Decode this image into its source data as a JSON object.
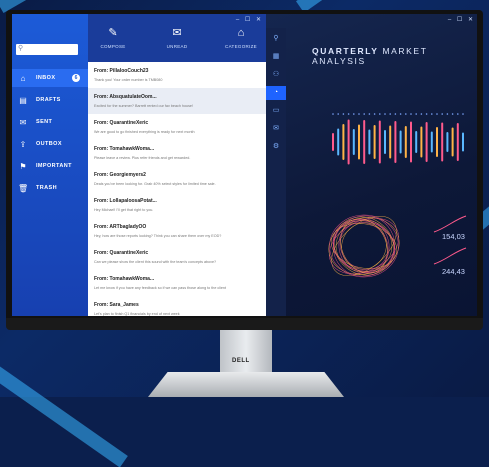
{
  "window_controls": "– ☐ ✕",
  "search": {
    "placeholder": ""
  },
  "sidebar": {
    "items": [
      {
        "label": "INBOX",
        "icon": "inbox-icon",
        "badge": "6"
      },
      {
        "label": "DRAFTS",
        "icon": "draft-icon"
      },
      {
        "label": "SENT",
        "icon": "sent-icon"
      },
      {
        "label": "OUTBOX",
        "icon": "outbox-icon"
      },
      {
        "label": "IMPORTANT",
        "icon": "flag-icon"
      },
      {
        "label": "TRASH",
        "icon": "trash-icon"
      }
    ]
  },
  "toolbar": {
    "compose": "COMPOSE",
    "unread": "UNREAD",
    "categorize": "CATEGORIZE"
  },
  "messages": [
    {
      "from": "From: PillalooCouch23",
      "snippet": "Thank you! Your order number is TMB080"
    },
    {
      "from": "From: AbsquatulateOom...",
      "snippet": "Excited for the summer? Barrett rented our fav beach house!"
    },
    {
      "from": "From: QuarantineXeric",
      "snippet": "We are good to go finished everything is ready for next month"
    },
    {
      "from": "From: TomahawkWoma...",
      "snippet": "Please leave a review. Plus refer friends and get rewarded."
    },
    {
      "from": "From: Georgiemyers2",
      "snippet": "Deals you've been looking for. Grab 40% select styles for limited time sale."
    },
    {
      "from": "From: LollapaloosaPotat...",
      "snippet": "Hey Michael! I'll get that right to you."
    },
    {
      "from": "From: ARTbagladyOO",
      "snippet": "Hey, how are those reports looking? Think you can share them over my EOD?"
    },
    {
      "from": "From: QuarantineXeric",
      "snippet": "Can we please show the client this sound with the team's concepts above?"
    },
    {
      "from": "From: TomahawkWoma...",
      "snippet": "Let me know if you have any feedback so if we can pass those along to the client"
    },
    {
      "from": "From: Sara_James",
      "snippet": "Let's plan to finish Q1 financials by end of next week"
    }
  ],
  "analytics": {
    "title_bold": "QUARTERLY",
    "title_rest": " MARKET ANALYSIS",
    "stat1": "154,03",
    "stat2": "244,43",
    "accent_colors": [
      "#ff5a8c",
      "#5ab8ff",
      "#ffb347"
    ]
  },
  "brand": "DELL"
}
